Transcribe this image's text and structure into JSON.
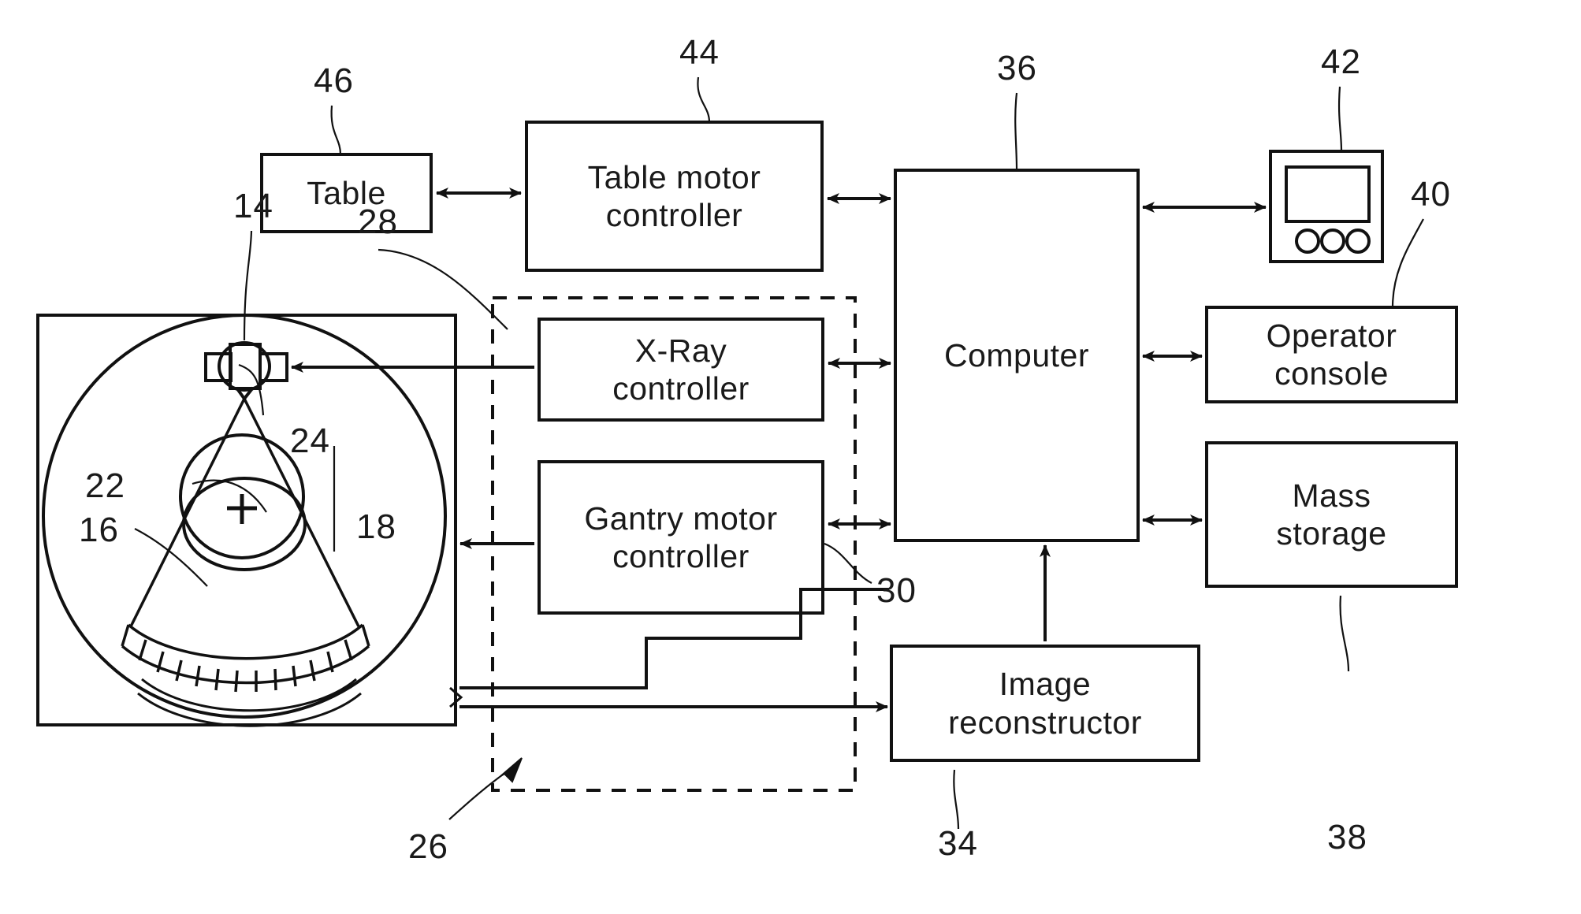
{
  "diagram": {
    "title": "CT imaging system block diagram",
    "stroke_color": "#111111",
    "background_color": "#ffffff"
  },
  "boxes": {
    "table": {
      "label": "Table",
      "ref": "46"
    },
    "table_motor_controller": {
      "label": "Table motor\ncontroller",
      "ref": "44"
    },
    "xray_controller": {
      "label": "X-Ray\ncontroller",
      "ref": "28"
    },
    "gantry_motor_controller": {
      "label": "Gantry motor\ncontroller",
      "ref": "30"
    },
    "computer": {
      "label": "Computer",
      "ref": "36"
    },
    "display": {
      "label": "",
      "ref": "42"
    },
    "operator_console": {
      "label": "Operator\nconsole",
      "ref": "40"
    },
    "mass_storage": {
      "label": "Mass\nstorage",
      "ref": "38"
    },
    "image_reconstructor": {
      "label": "Image\nreconstructor",
      "ref": "34"
    },
    "gantry": {
      "label": "",
      "ref": "14"
    },
    "control_mechanism": {
      "label": "",
      "ref": "26"
    }
  },
  "reference_numerals": [
    {
      "id": "46",
      "value": "46",
      "target": "table"
    },
    {
      "id": "44",
      "value": "44",
      "target": "table-motor-controller"
    },
    {
      "id": "36",
      "value": "36",
      "target": "computer"
    },
    {
      "id": "42",
      "value": "42",
      "target": "display"
    },
    {
      "id": "40",
      "value": "40",
      "target": "operator-console"
    },
    {
      "id": "14",
      "value": "14",
      "target": "x-ray-source"
    },
    {
      "id": "28",
      "value": "28",
      "target": "x-ray-controller"
    },
    {
      "id": "24",
      "value": "24",
      "target": "object-inner"
    },
    {
      "id": "22",
      "value": "22",
      "target": "object-outer"
    },
    {
      "id": "16",
      "value": "16",
      "target": "x-ray-beam"
    },
    {
      "id": "18",
      "value": "18",
      "target": "detector-array"
    },
    {
      "id": "30",
      "value": "30",
      "target": "gantry-motor-controller"
    },
    {
      "id": "38",
      "value": "38",
      "target": "mass-storage"
    },
    {
      "id": "34",
      "value": "34",
      "target": "image-reconstructor"
    },
    {
      "id": "26",
      "value": "26",
      "target": "control-mechanism"
    }
  ],
  "gantry_parts": {
    "source_ref": "14",
    "beam_ref": "16",
    "detector_ref": "18",
    "object_outer_ref": "22",
    "object_inner_ref": "24",
    "detector_cell_count": 13,
    "isocenter_marker": "+"
  },
  "display_icon": {
    "name": "display-monitor-icon",
    "knob_count": 3
  }
}
